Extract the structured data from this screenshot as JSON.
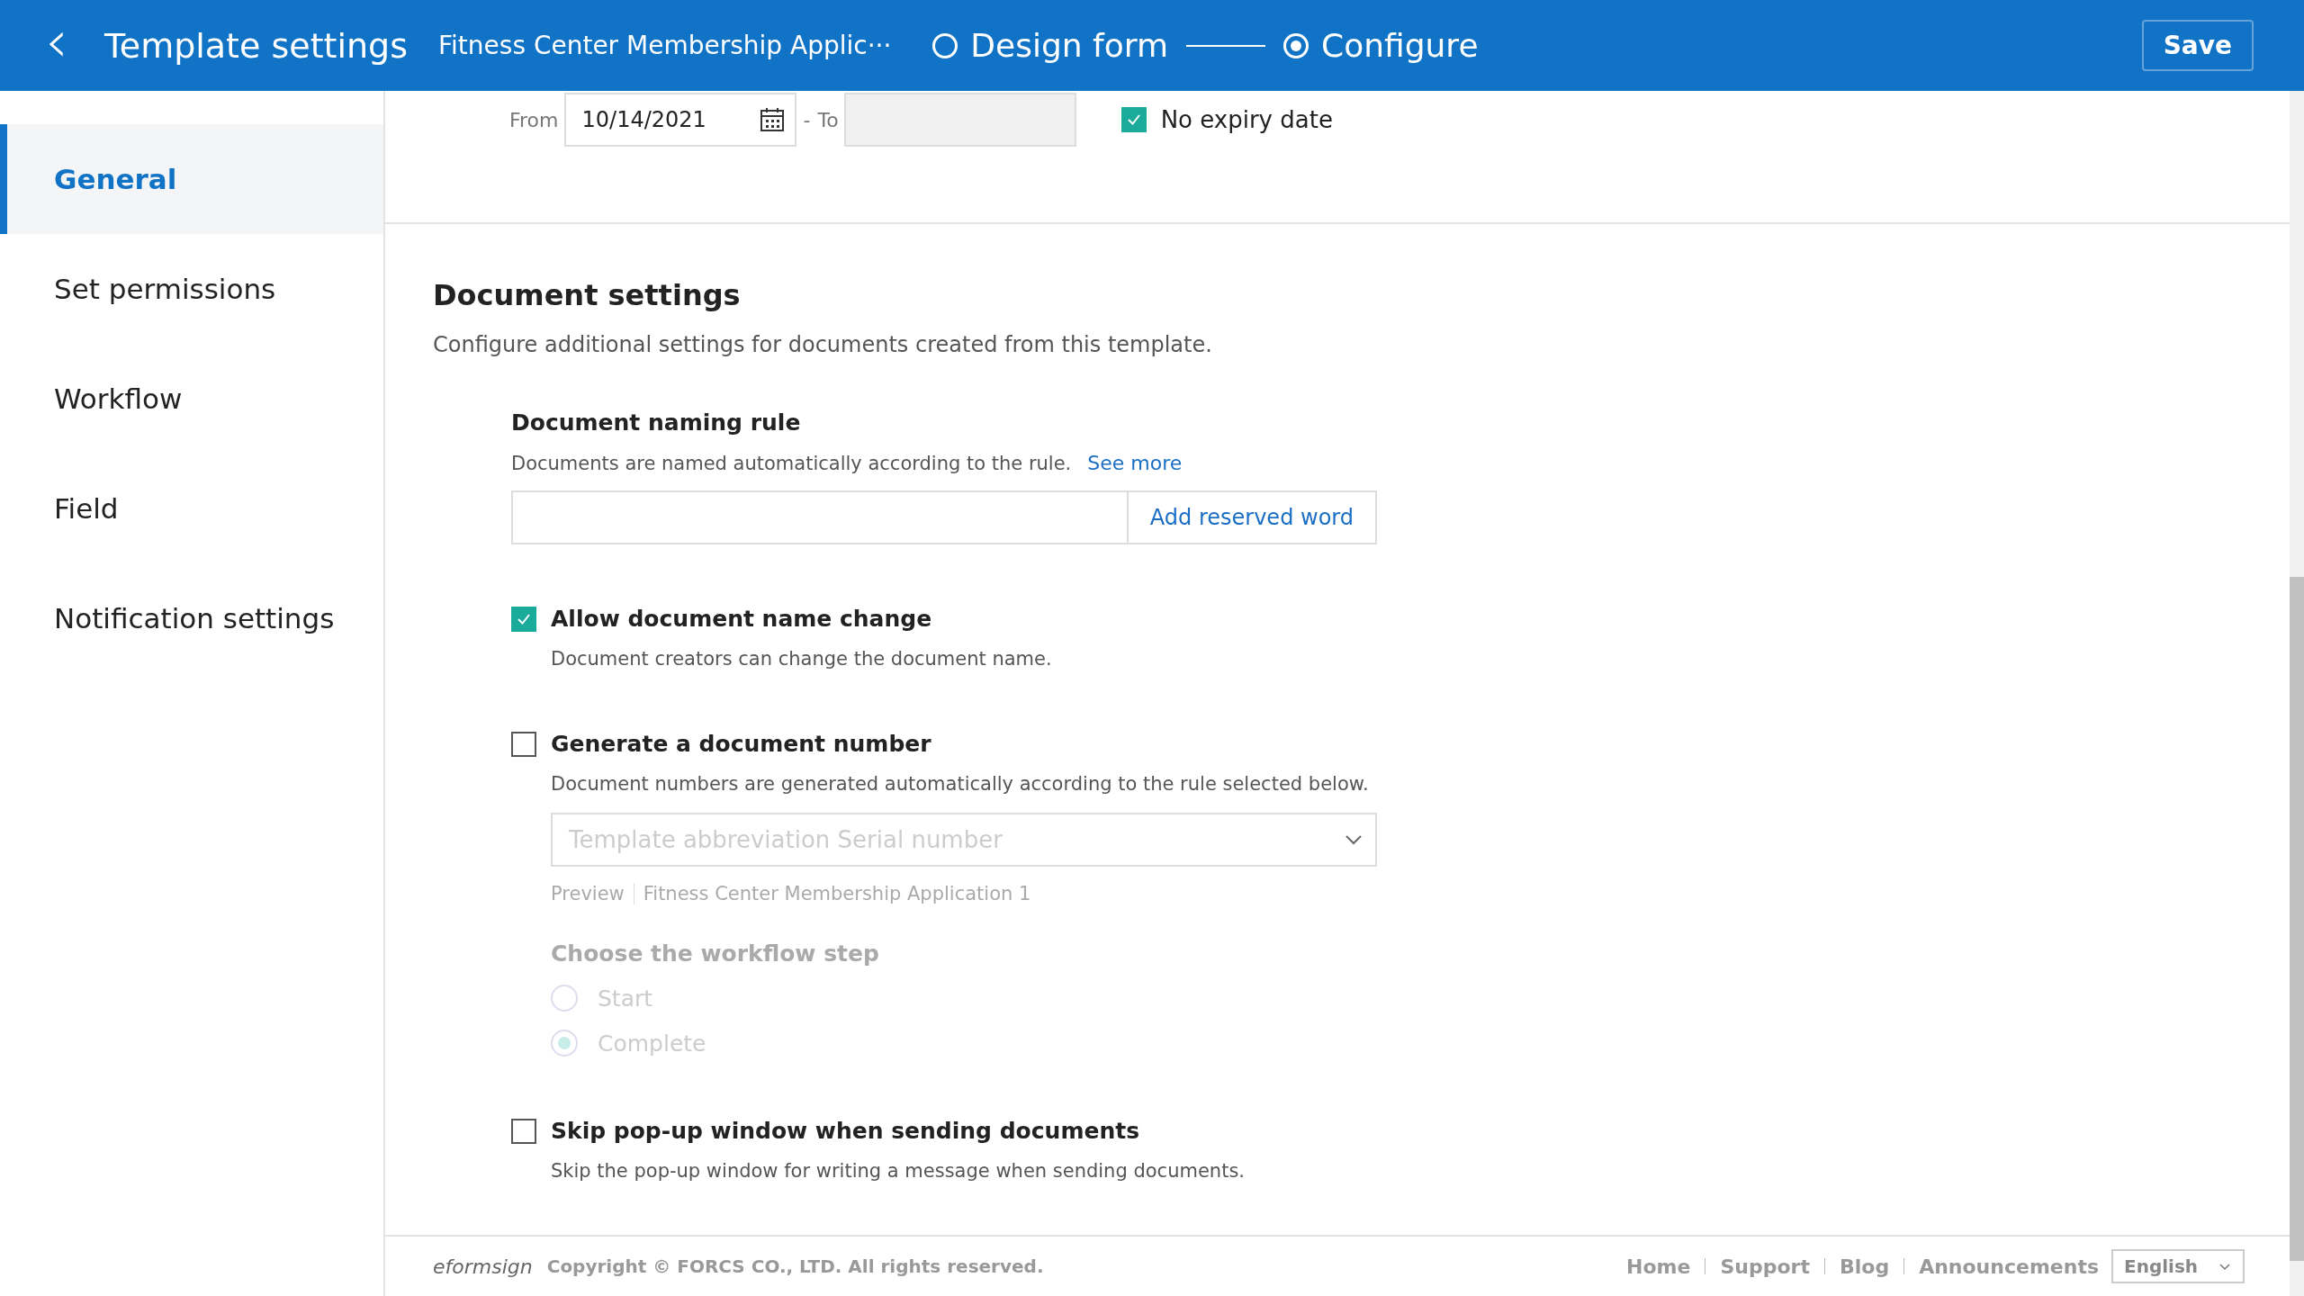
{
  "header": {
    "back": "‹",
    "title": "Template settings",
    "document_name": "Fitness Center Membership Applic···",
    "steps": [
      {
        "label": "Design form",
        "selected": false
      },
      {
        "label": "Configure",
        "selected": true
      }
    ],
    "save_button": "Save"
  },
  "validity": {
    "from_label": "From",
    "from_value": "10/14/2021",
    "separator": "-",
    "to_label": "To",
    "to_disabled": true,
    "no_expiry": {
      "label": "No expiry date",
      "checked": true
    }
  },
  "sidebar": {
    "items": [
      {
        "label": "General",
        "selected": true
      },
      {
        "label": "Set permissions",
        "selected": false
      },
      {
        "label": "Workflow",
        "selected": false
      },
      {
        "label": "Field",
        "selected": false
      },
      {
        "label": "Notification settings",
        "selected": false
      }
    ]
  },
  "document_settings": {
    "title": "Document settings",
    "description": "Configure additional settings for documents created from this template.",
    "naming_rule": {
      "title": "Document naming rule",
      "description": "Documents are named automatically according to the rule.",
      "link": "See more",
      "button": "Add reserved word"
    },
    "options": [
      {
        "label": "Allow document name change",
        "description": "Document creators can change the document name.",
        "checked": true
      },
      {
        "label": "Generate a document number",
        "description": "Document numbers are generated automatically according to the rule selected below.",
        "checked": false,
        "details": {
          "disabled": true,
          "dropdown": "Template abbreviation Serial number",
          "preview_label": "Preview",
          "preview_value": "Fitness Center Membership Application 1",
          "step_title": "Choose the workflow step",
          "steps": [
            {
              "label": "Start",
              "selected": false
            },
            {
              "label": "Complete",
              "selected": true
            }
          ]
        }
      },
      {
        "label": "Skip pop-up window when sending documents",
        "description": "Skip the pop-up window for writing a message when sending documents.",
        "checked": false
      }
    ]
  },
  "footer": {
    "logo": "eformsign",
    "copyright": "Copyright © FORCS CO., LTD. All rights reserved.",
    "links": [
      "Home",
      "Support",
      "Blog",
      "Announcements"
    ],
    "language": "English"
  }
}
